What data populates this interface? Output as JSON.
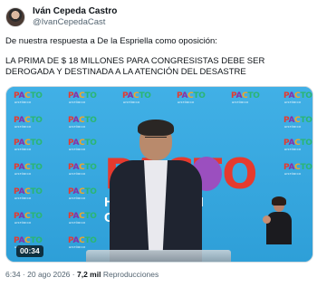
{
  "author": {
    "name": "Iván Cepeda Castro",
    "handle": "@IvanCepedaCast"
  },
  "tweet": {
    "line1": "De nuestra respuesta a De la Espriella como oposición:",
    "line2": "LA PRIMA DE $ 18 MILLONES PARA CONGRESISTAS DEBE SER DEROGADA Y DESTINADA A LA ATENCIÓN DEL DESASTRE"
  },
  "media": {
    "duration": "00:34",
    "brand_word": [
      "P",
      "A",
      "C",
      "TO"
    ],
    "brand_sub": "HISTÓRICO",
    "big_logo_letters": "PACTO",
    "big_logo_sub": "H I S T Ó R I C O",
    "colors": {
      "backdrop": "#3aa8df",
      "brand_red": "#e63a2e",
      "brand_purple": "#8a2ea5"
    }
  },
  "footer": {
    "time": "6:34",
    "date": "20 ago 2026",
    "views_count": "7,2 mil",
    "views_label": "Reproducciones"
  }
}
